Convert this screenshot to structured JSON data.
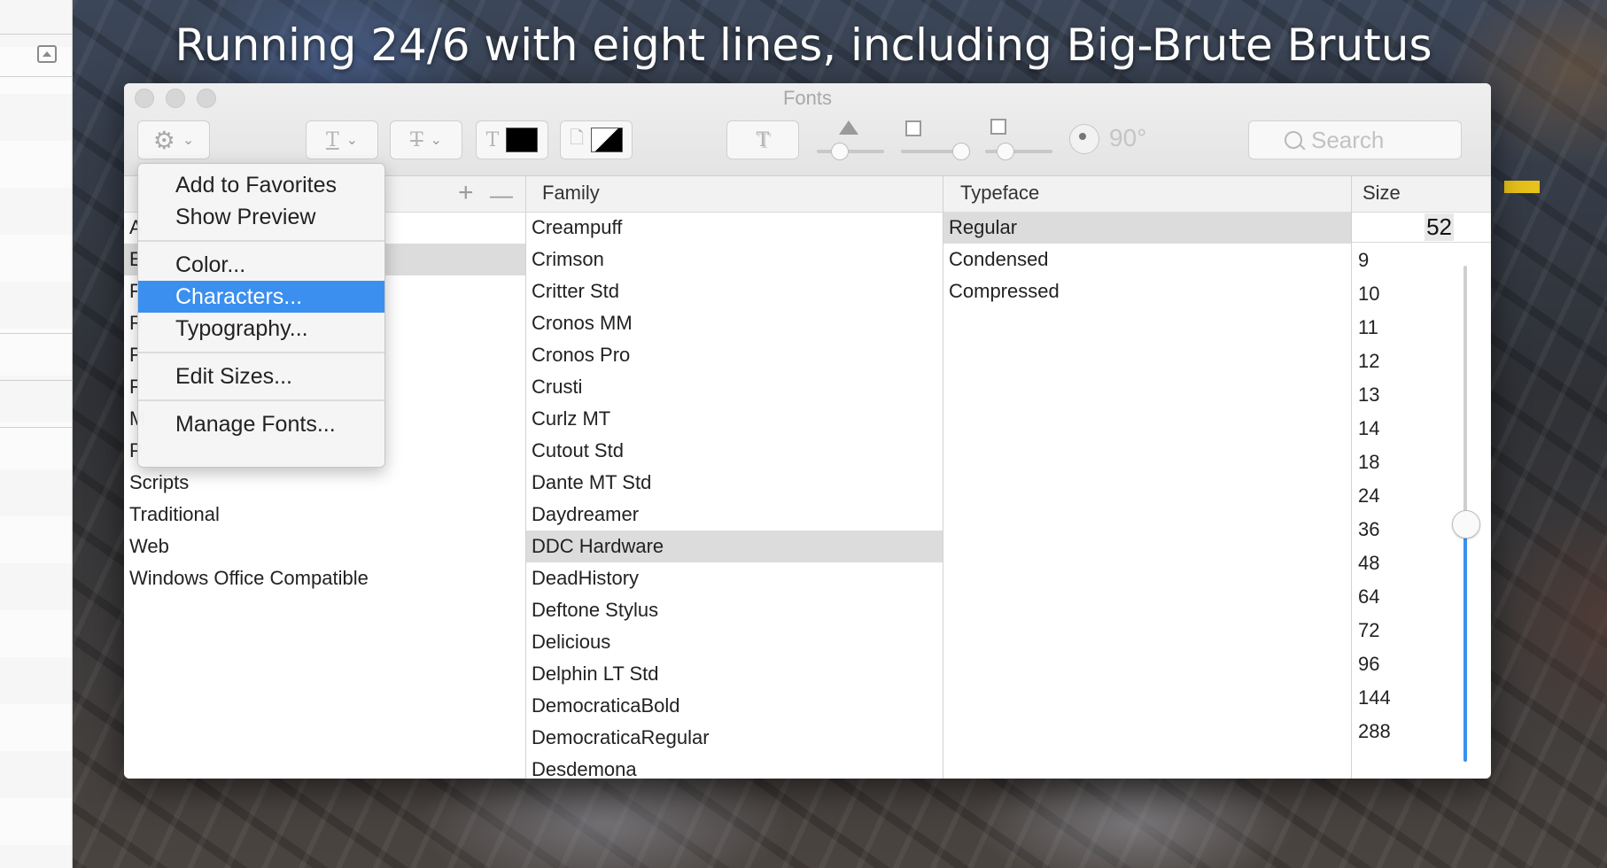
{
  "caption": "Running 24/6 with eight lines, including Big-Brute Brutus",
  "window": {
    "title": "Fonts"
  },
  "toolbar": {
    "gear_icon": "gear-icon",
    "underline_glyph": "T",
    "strike_glyph": "T",
    "text_color_glyph": "T",
    "text_color": "#000000",
    "angle": "90°",
    "search_placeholder": "Search"
  },
  "headers": {
    "plus": "+",
    "minus": "—",
    "family": "Family",
    "typeface": "Typeface",
    "size": "Size"
  },
  "collections": {
    "items": [
      "A",
      "E",
      "F",
      "R",
      "F",
      "F",
      "M",
      "P",
      "Scripts",
      "Traditional",
      "Web",
      "Windows Office Compatible"
    ],
    "selected": "E"
  },
  "families": {
    "items": [
      "Creampuff",
      "Crimson",
      "Critter Std",
      "Cronos MM",
      "Cronos Pro",
      "Crusti",
      "Curlz MT",
      "Cutout Std",
      "Dante MT Std",
      "Daydreamer",
      "DDC Hardware",
      "DeadHistory",
      "Deftone Stylus",
      "Delicious",
      "Delphin LT Std",
      "DemocraticaBold",
      "DemocraticaRegular",
      "Desdemona"
    ],
    "selected": "DDC Hardware"
  },
  "typefaces": {
    "items": [
      "Regular",
      "Condensed",
      "Compressed"
    ],
    "selected": "Regular"
  },
  "sizes": {
    "current": "52",
    "items": [
      "9",
      "10",
      "11",
      "12",
      "13",
      "14",
      "18",
      "24",
      "36",
      "48",
      "64",
      "72",
      "96",
      "144",
      "288"
    ],
    "slider_fraction": 0.52
  },
  "menu": {
    "add_favorites": "Add to Favorites",
    "show_preview": "Show Preview",
    "color": "Color...",
    "characters": "Characters...",
    "typography": "Typography...",
    "edit_sizes": "Edit Sizes...",
    "manage_fonts": "Manage Fonts...",
    "highlighted": "Characters..."
  },
  "colors": {
    "accent": "#3b8fee",
    "selection_gray": "#dcdcdc",
    "tag_yellow": "#e8c21a"
  }
}
